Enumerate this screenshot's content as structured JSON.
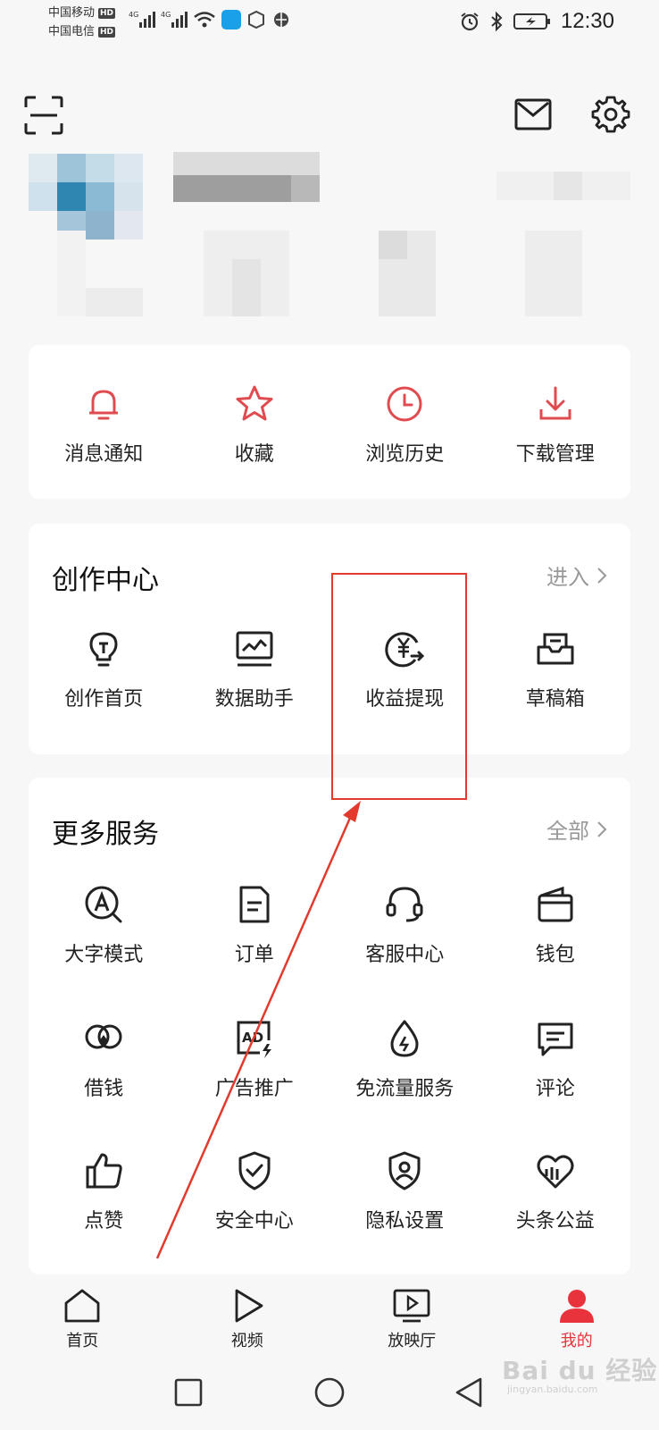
{
  "status_bar": {
    "carrier1": "中国移动",
    "carrier2": "中国电信",
    "hd_badge": "HD",
    "network": "4G",
    "time": "12:30"
  },
  "quick_actions": [
    {
      "label": "消息通知",
      "icon": "bell-icon"
    },
    {
      "label": "收藏",
      "icon": "star-icon"
    },
    {
      "label": "浏览历史",
      "icon": "clock-icon"
    },
    {
      "label": "下载管理",
      "icon": "download-icon"
    }
  ],
  "creator_center": {
    "title": "创作中心",
    "more": "进入",
    "items": [
      {
        "label": "创作首页",
        "icon": "lightbulb-icon"
      },
      {
        "label": "数据助手",
        "icon": "chart-monitor-icon"
      },
      {
        "label": "收益提现",
        "icon": "yuan-withdraw-icon"
      },
      {
        "label": "草稿箱",
        "icon": "draft-box-icon"
      }
    ]
  },
  "more_services": {
    "title": "更多服务",
    "more": "全部",
    "rows": [
      [
        {
          "label": "大字模式",
          "icon": "large-font-icon"
        },
        {
          "label": "订单",
          "icon": "order-icon"
        },
        {
          "label": "客服中心",
          "icon": "headset-icon"
        },
        {
          "label": "钱包",
          "icon": "wallet-icon"
        }
      ],
      [
        {
          "label": "借钱",
          "icon": "loan-icon"
        },
        {
          "label": "广告推广",
          "icon": "ad-icon"
        },
        {
          "label": "免流量服务",
          "icon": "data-drop-icon"
        },
        {
          "label": "评论",
          "icon": "comment-icon"
        }
      ],
      [
        {
          "label": "点赞",
          "icon": "thumbs-up-icon"
        },
        {
          "label": "安全中心",
          "icon": "shield-check-icon"
        },
        {
          "label": "隐私设置",
          "icon": "privacy-icon"
        },
        {
          "label": "头条公益",
          "icon": "charity-icon"
        }
      ]
    ]
  },
  "bottom_nav": [
    {
      "label": "首页",
      "icon": "home-icon"
    },
    {
      "label": "视频",
      "icon": "play-icon"
    },
    {
      "label": "放映厅",
      "icon": "tv-icon"
    },
    {
      "label": "我的",
      "icon": "user-icon",
      "active": true
    }
  ],
  "colors": {
    "accent_red": "#e8333c",
    "icon_red": "#e04b4f",
    "annotation_red": "#e23b2d"
  },
  "watermark": {
    "main": "Bai du 经验",
    "sub": "jingyan.baidu.com"
  }
}
